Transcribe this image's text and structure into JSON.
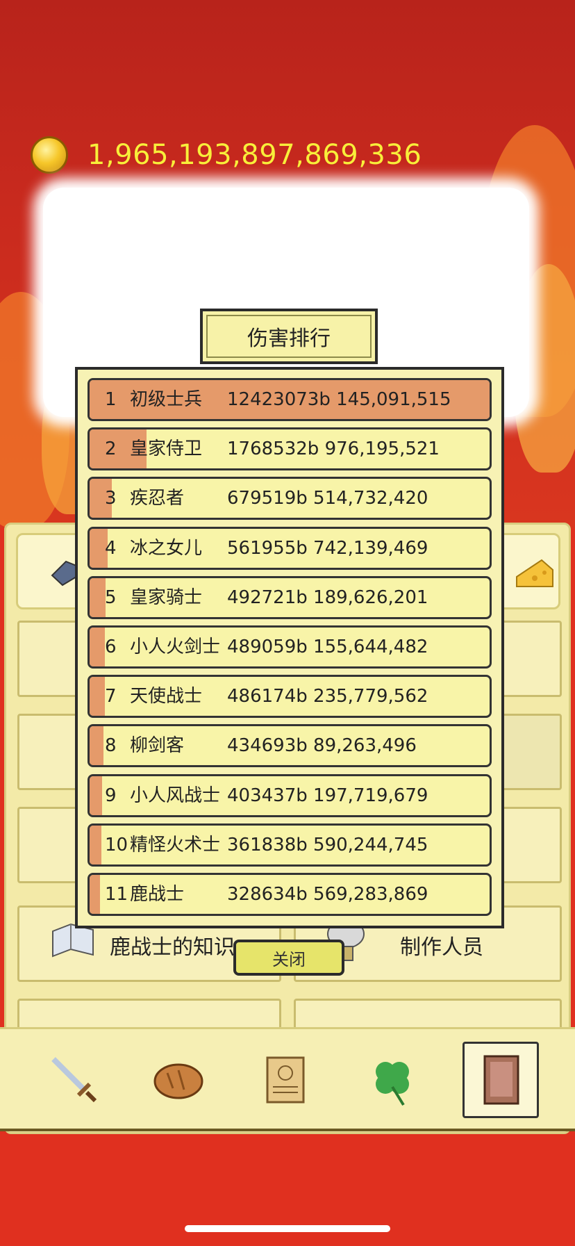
{
  "gold": {
    "amount": "1,965,193,897,869,336"
  },
  "modal": {
    "title": "伤害排行",
    "close_label": "关闭",
    "rows": [
      {
        "rank": "1",
        "name": "初级士兵",
        "value": "12423073b 145,091,515",
        "bar": 1.0
      },
      {
        "rank": "2",
        "name": "皇家侍卫",
        "value": "1768532b 976,195,521",
        "bar": 0.142
      },
      {
        "rank": "3",
        "name": "疾忍者",
        "value": "679519b 514,732,420",
        "bar": 0.055
      },
      {
        "rank": "4",
        "name": "冰之女儿",
        "value": "561955b 742,139,469",
        "bar": 0.045
      },
      {
        "rank": "5",
        "name": "皇家骑士",
        "value": "492721b 189,626,201",
        "bar": 0.04
      },
      {
        "rank": "6",
        "name": "小人火剑士",
        "value": "489059b 155,644,482",
        "bar": 0.039
      },
      {
        "rank": "7",
        "name": "天使战士",
        "value": "486174b 235,779,562",
        "bar": 0.039
      },
      {
        "rank": "8",
        "name": "柳剑客",
        "value": "434693b 89,263,496",
        "bar": 0.035
      },
      {
        "rank": "9",
        "name": "小人风战士",
        "value": "403437b 197,719,679",
        "bar": 0.032
      },
      {
        "rank": "10",
        "name": "精怪火术士",
        "value": "361838b 590,244,745",
        "bar": 0.029
      },
      {
        "rank": "11",
        "name": "鹿战士",
        "value": "328634b 569,283,869",
        "bar": 0.026
      }
    ]
  },
  "background_panel": {
    "left_label": "鹿战士的知识",
    "right_label": "制作人员"
  },
  "bottom_nav": {
    "items": [
      "sword-icon",
      "bread-icon",
      "scroll-icon",
      "clover-icon",
      "book-icon"
    ],
    "active_index": 4
  },
  "colors": {
    "bar_fill": "#e59a6a",
    "gold_text": "#f8ef3a",
    "row_bg": "#f8f4a8"
  }
}
